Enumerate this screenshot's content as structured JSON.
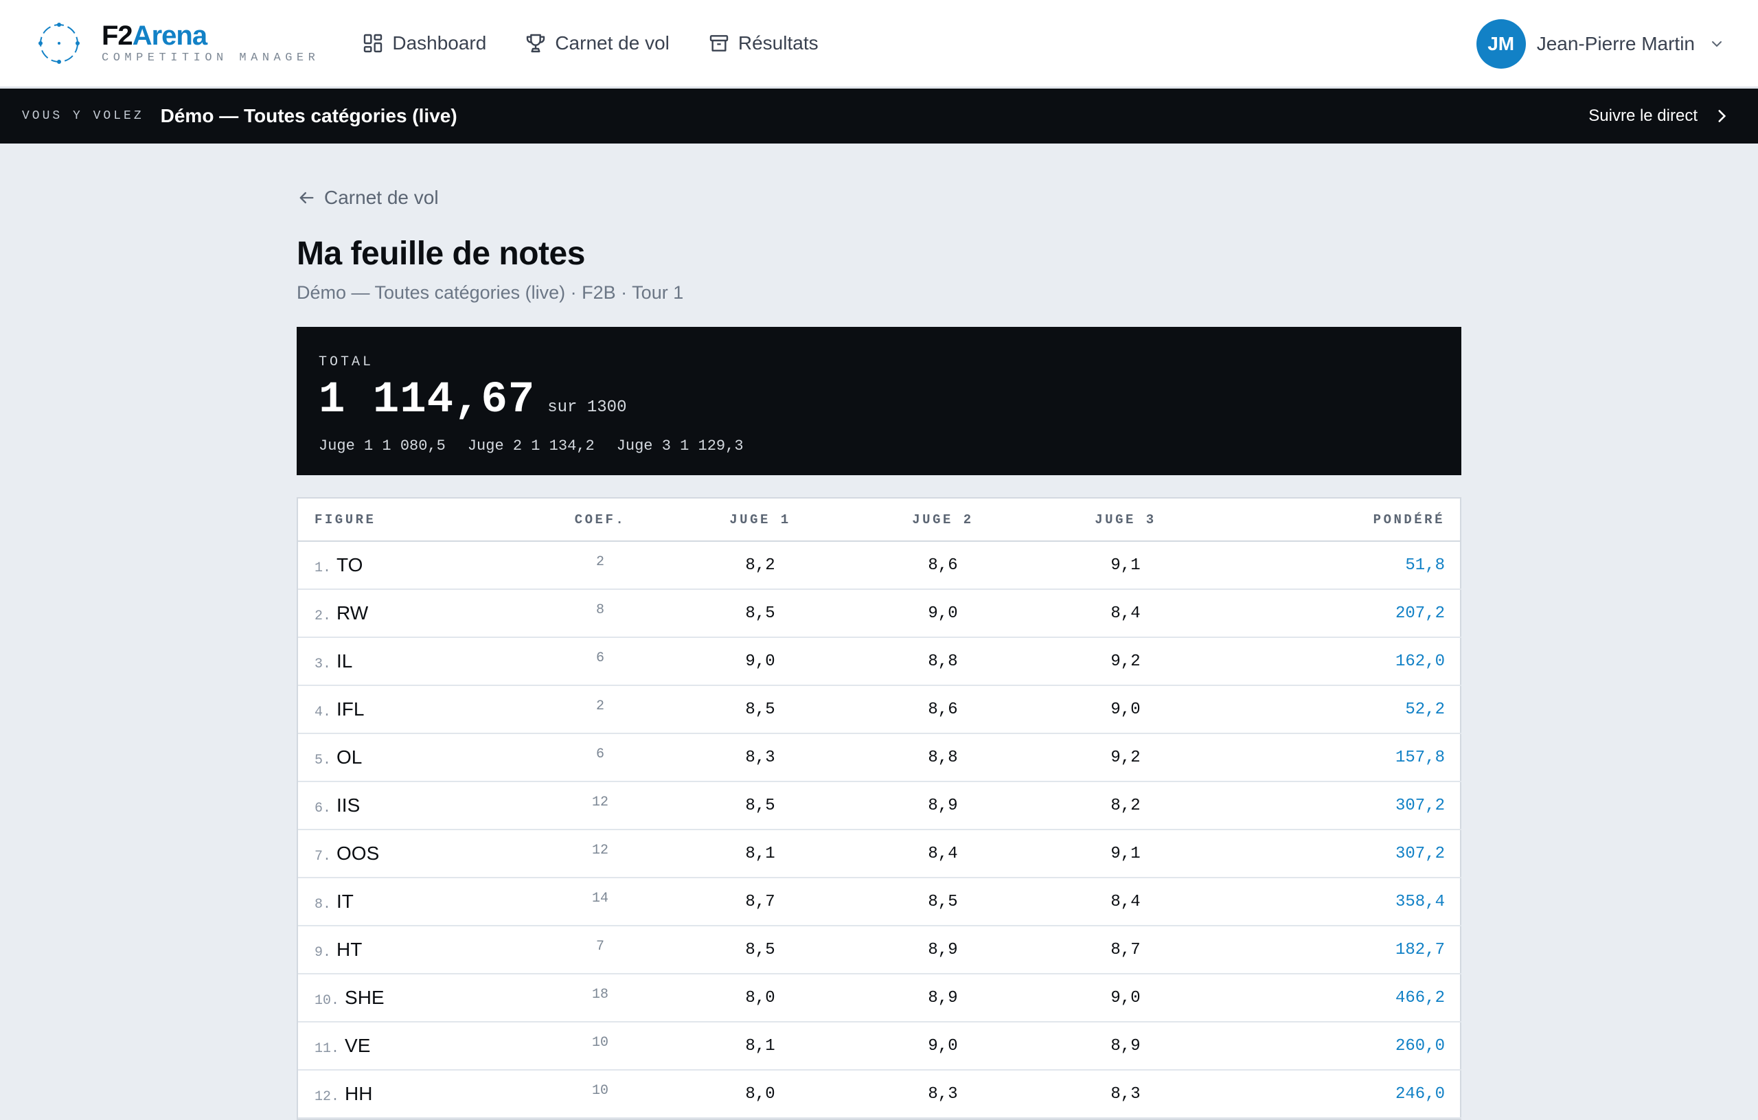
{
  "app": {
    "name_part1": "F2",
    "name_part2": "Arena",
    "tagline": "COMPETITION MANAGER"
  },
  "nav": {
    "items": [
      {
        "label": "Dashboard",
        "icon": "grid-icon"
      },
      {
        "label": "Carnet de vol",
        "icon": "trophy-icon"
      },
      {
        "label": "Résultats",
        "icon": "archive-icon"
      }
    ]
  },
  "user": {
    "initials": "JM",
    "name": "Jean-Pierre Martin"
  },
  "livebar": {
    "kicker": "VOUS Y VOLEZ",
    "event": "Démo — Toutes catégories (live)",
    "follow_label": "Suivre le direct"
  },
  "page": {
    "back_label": "Carnet de vol",
    "title": "Ma feuille de notes",
    "subtitle": "Démo — Toutes catégories (live) · F2B · Tour 1"
  },
  "total": {
    "label": "TOTAL",
    "value": "1 114,67",
    "max": "sur 1300",
    "judges": [
      "Juge 1 1 080,5",
      "Juge 2 1 134,2",
      "Juge 3 1 129,3"
    ]
  },
  "table": {
    "headers": {
      "figure": "FIGURE",
      "coef": "COEF.",
      "j1": "JUGE 1",
      "j2": "JUGE 2",
      "j3": "JUGE 3",
      "weighted": "PONDÉRÉ"
    },
    "rows": [
      {
        "n": "1.",
        "figure": "TO",
        "coef": "2",
        "j1": "8,2",
        "j2": "8,6",
        "j3": "9,1",
        "weighted": "51,8"
      },
      {
        "n": "2.",
        "figure": "RW",
        "coef": "8",
        "j1": "8,5",
        "j2": "9,0",
        "j3": "8,4",
        "weighted": "207,2"
      },
      {
        "n": "3.",
        "figure": "IL",
        "coef": "6",
        "j1": "9,0",
        "j2": "8,8",
        "j3": "9,2",
        "weighted": "162,0"
      },
      {
        "n": "4.",
        "figure": "IFL",
        "coef": "2",
        "j1": "8,5",
        "j2": "8,6",
        "j3": "9,0",
        "weighted": "52,2"
      },
      {
        "n": "5.",
        "figure": "OL",
        "coef": "6",
        "j1": "8,3",
        "j2": "8,8",
        "j3": "9,2",
        "weighted": "157,8"
      },
      {
        "n": "6.",
        "figure": "IIS",
        "coef": "12",
        "j1": "8,5",
        "j2": "8,9",
        "j3": "8,2",
        "weighted": "307,2"
      },
      {
        "n": "7.",
        "figure": "OOS",
        "coef": "12",
        "j1": "8,1",
        "j2": "8,4",
        "j3": "9,1",
        "weighted": "307,2"
      },
      {
        "n": "8.",
        "figure": "IT",
        "coef": "14",
        "j1": "8,7",
        "j2": "8,5",
        "j3": "8,4",
        "weighted": "358,4"
      },
      {
        "n": "9.",
        "figure": "HT",
        "coef": "7",
        "j1": "8,5",
        "j2": "8,9",
        "j3": "8,7",
        "weighted": "182,7"
      },
      {
        "n": "10.",
        "figure": "SHE",
        "coef": "18",
        "j1": "8,0",
        "j2": "8,9",
        "j3": "9,0",
        "weighted": "466,2"
      },
      {
        "n": "11.",
        "figure": "VE",
        "coef": "10",
        "j1": "8,1",
        "j2": "9,0",
        "j3": "8,9",
        "weighted": "260,0"
      },
      {
        "n": "12.",
        "figure": "HH",
        "coef": "10",
        "j1": "8,0",
        "j2": "8,3",
        "j3": "8,3",
        "weighted": "246,0"
      }
    ]
  },
  "colors": {
    "accent": "#1281c6",
    "dark": "#0b0e12",
    "background": "#e9edf2"
  }
}
